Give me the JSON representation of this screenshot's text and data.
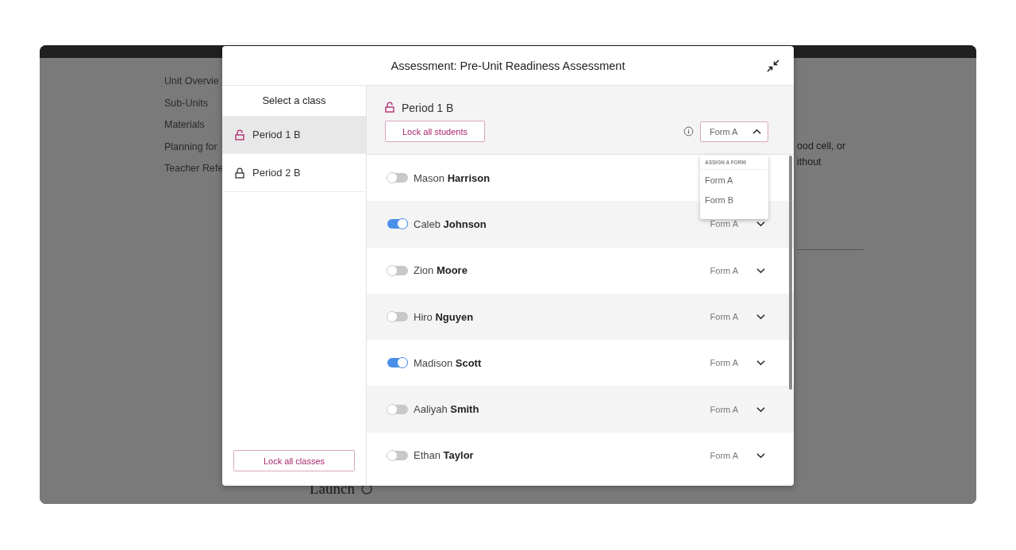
{
  "background": {
    "nav_items": [
      "Unit Overvie",
      "Sub-Units",
      "Materials",
      "Planning for",
      "Teacher Refe"
    ],
    "text_lines": [
      "ood cell, or",
      "ithout"
    ],
    "launch_label": "Launch"
  },
  "dialog": {
    "title": "Assessment: Pre-Unit Readiness Assessment",
    "class_panel": {
      "heading": "Select a class",
      "classes": [
        {
          "name": "Period 1 B",
          "locked": false,
          "selected": true
        },
        {
          "name": "Period 2 B",
          "locked": true,
          "selected": false
        }
      ],
      "lock_all_button": "Lock all classes"
    },
    "class_detail": {
      "name": "Period 1 B",
      "locked": false,
      "lock_all_button": "Lock all students",
      "form_select": {
        "value": "Form A",
        "expanded": true,
        "menu_heading": "ASSIGN A FORM",
        "options": [
          "Form A",
          "Form B"
        ]
      }
    },
    "students": [
      {
        "name": "Mason **Harrison**",
        "on": false
      },
      {
        "name": "Caleb **Johnson**",
        "on": true,
        "form": "Form A"
      },
      {
        "name": "Zion **Moore**",
        "on": false,
        "form": "Form A"
      },
      {
        "name": "Hiro **Nguyen**",
        "on": false,
        "form": "Form A"
      },
      {
        "name": "Madison **Scott**",
        "on": true,
        "form": "Form A"
      },
      {
        "name": "Aaliyah **Smith**",
        "on": false,
        "form": "Form A"
      },
      {
        "name": "Ethan **Taylor**",
        "on": false,
        "form": "Form A"
      }
    ]
  }
}
